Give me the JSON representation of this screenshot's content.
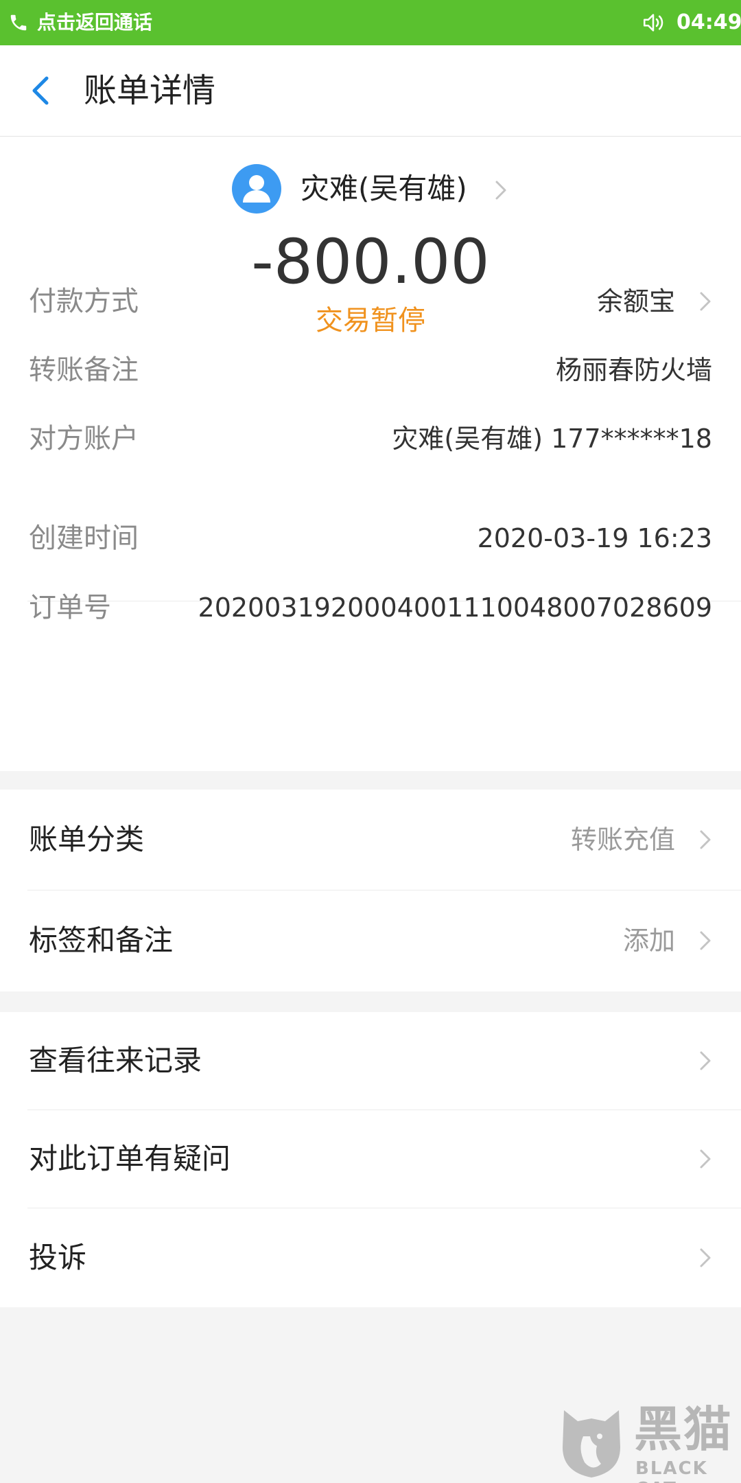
{
  "call_bar": {
    "text": "点击返回通话",
    "time": "04:49",
    "background_color": "#5ac12f"
  },
  "header": {
    "back_icon": "chevron-left-icon",
    "title": "账单详情"
  },
  "summary": {
    "avatar_icon": "user-avatar-icon",
    "payee_name": "灾难(吴有雄)",
    "amount": "-800.00",
    "status": "交易暂停",
    "status_color": "#f0921e"
  },
  "details": [
    {
      "label": "付款方式",
      "value": "余额宝",
      "has_chevron": true
    },
    {
      "label": "转账备注",
      "value": "杨丽春防火墙",
      "has_chevron": false
    },
    {
      "label": "对方账户",
      "value": "灾难(吴有雄) 177******18",
      "has_chevron": false
    },
    {
      "label": "创建时间",
      "value": "2020-03-19 16:23",
      "has_chevron": false
    },
    {
      "label": "订单号",
      "value": "2020031920004001110048007028609",
      "has_chevron": false
    }
  ],
  "bill_settings": [
    {
      "label": "账单分类",
      "value": "转账充值"
    },
    {
      "label": "标签和备注",
      "value": "添加"
    }
  ],
  "actions": [
    {
      "label": "查看往来记录"
    },
    {
      "label": "对此订单有疑问"
    },
    {
      "label": "投诉"
    }
  ],
  "watermark": {
    "cn": "黑猫",
    "en": "BLACK CAT"
  }
}
